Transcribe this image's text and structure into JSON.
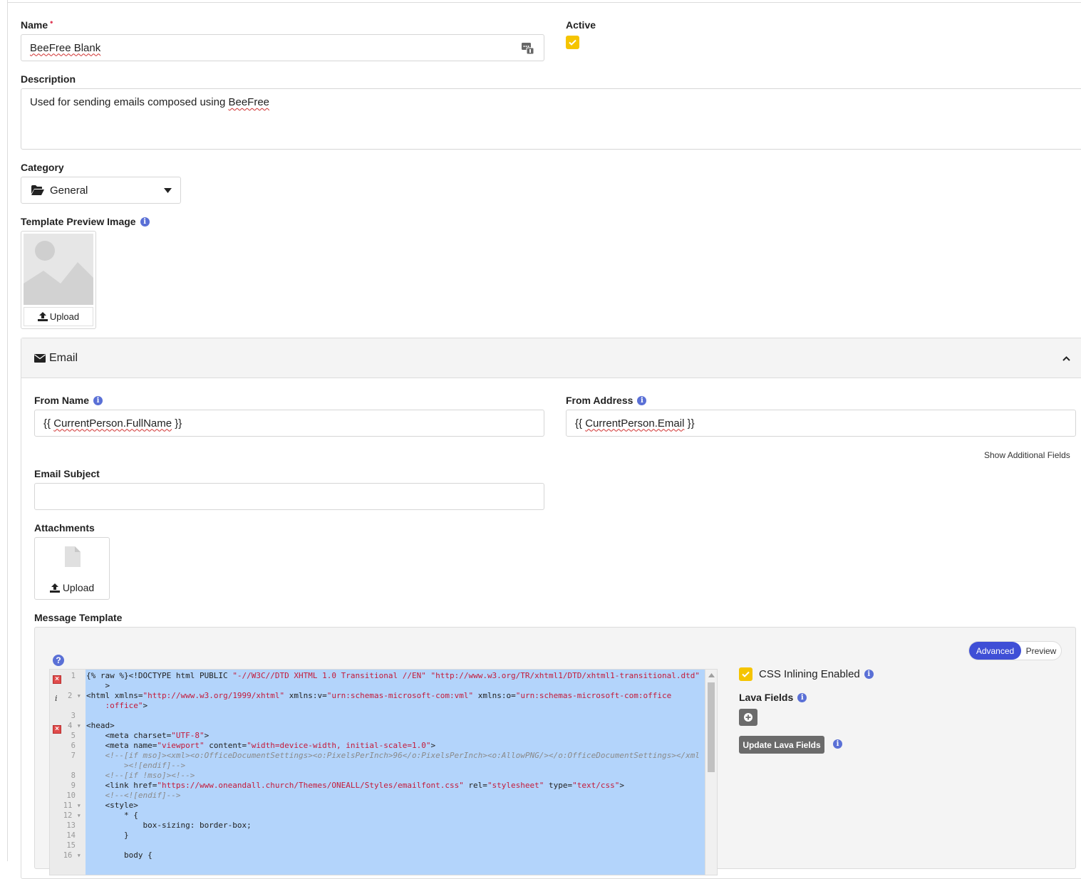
{
  "form": {
    "name_label": "Name",
    "name_required_marker": "•",
    "name_value": "BeeFree Blank",
    "active_label": "Active",
    "description_label": "Description",
    "description_value_prefix": "Used for sending emails composed using ",
    "description_value_word": "BeeFree",
    "category_label": "Category",
    "category_value": "General",
    "preview_image_label": "Template Preview Image",
    "preview_upload_label": "Upload"
  },
  "email_panel": {
    "title": "Email",
    "from_name_label": "From Name",
    "from_name_value_open": "{{ ",
    "from_name_value_word": "CurrentPerson.FullName",
    "from_name_value_close": " }}",
    "from_address_label": "From Address",
    "from_address_value_open": "{{ ",
    "from_address_value_word": "CurrentPerson.Email",
    "from_address_value_close": " }}",
    "show_additional_fields": "Show Additional Fields",
    "email_subject_label": "Email Subject",
    "email_subject_value": "",
    "attachments_label": "Attachments",
    "attachments_upload_label": "Upload",
    "message_template_label": "Message Template"
  },
  "editor": {
    "mode_advanced": "Advanced",
    "mode_preview": "Preview",
    "help_icon": "question-circle-icon",
    "css_inlining_label": "CSS Inlining Enabled",
    "lava_fields_label": "Lava Fields",
    "update_lava_fields": "Update Lava Fields",
    "code_lines": [
      {
        "n": "1",
        "fold": false,
        "gutter": "error",
        "parts": [
          [
            "p",
            "{% raw %}<!DOCTYPE html PUBLIC "
          ],
          [
            "s",
            "\"-//W3C//DTD XHTML 1.0 Transitional //EN\""
          ],
          [
            "p",
            " "
          ],
          [
            "s",
            "\"http://www.w3.org/TR/xhtml1/DTD/xhtml1-transitional.dtd\""
          ]
        ]
      },
      {
        "n": "",
        "fold": false,
        "gutter": "",
        "parts": [
          [
            "p",
            "    >"
          ]
        ]
      },
      {
        "n": "2",
        "fold": true,
        "gutter": "info",
        "parts": [
          [
            "p",
            "<html xmlns="
          ],
          [
            "s",
            "\"http://www.w3.org/1999/xhtml\""
          ],
          [
            "p",
            " xmlns:v="
          ],
          [
            "s",
            "\"urn:schemas-microsoft-com:vml\""
          ],
          [
            "p",
            " xmlns:o="
          ],
          [
            "s",
            "\"urn:schemas-microsoft-com:office"
          ]
        ]
      },
      {
        "n": "",
        "fold": false,
        "gutter": "",
        "parts": [
          [
            "s",
            "    :office\""
          ],
          [
            "p",
            ">"
          ]
        ]
      },
      {
        "n": "3",
        "fold": false,
        "gutter": "",
        "parts": []
      },
      {
        "n": "4",
        "fold": true,
        "gutter": "error",
        "parts": [
          [
            "p",
            "<head>"
          ]
        ]
      },
      {
        "n": "5",
        "fold": false,
        "gutter": "",
        "parts": [
          [
            "p",
            "    <meta charset="
          ],
          [
            "s",
            "\"UTF-8\""
          ],
          [
            "p",
            ">"
          ]
        ]
      },
      {
        "n": "6",
        "fold": false,
        "gutter": "",
        "parts": [
          [
            "p",
            "    <meta name="
          ],
          [
            "s",
            "\"viewport\""
          ],
          [
            "p",
            " content="
          ],
          [
            "s",
            "\"width=device-width, initial-scale=1.0\""
          ],
          [
            "p",
            ">"
          ]
        ]
      },
      {
        "n": "7",
        "fold": false,
        "gutter": "",
        "parts": [
          [
            "c",
            "    <!--[if mso]><xml><o:OfficeDocumentSettings><o:PixelsPerInch>96</o:PixelsPerInch><o:AllowPNG/></o:OfficeDocumentSettings></xml"
          ]
        ]
      },
      {
        "n": "",
        "fold": false,
        "gutter": "",
        "parts": [
          [
            "c",
            "        ><![endif]-->"
          ]
        ]
      },
      {
        "n": "8",
        "fold": false,
        "gutter": "",
        "parts": [
          [
            "c",
            "    <!--[if !mso]><!-->"
          ]
        ]
      },
      {
        "n": "9",
        "fold": false,
        "gutter": "",
        "parts": [
          [
            "p",
            "    <link href="
          ],
          [
            "s",
            "\"https://www.oneandall.church/Themes/ONEALL/Styles/emailfont.css\""
          ],
          [
            "p",
            " rel="
          ],
          [
            "s",
            "\"stylesheet\""
          ],
          [
            "p",
            " type="
          ],
          [
            "s",
            "\"text/css\""
          ],
          [
            "p",
            ">"
          ]
        ]
      },
      {
        "n": "10",
        "fold": false,
        "gutter": "",
        "parts": [
          [
            "c",
            "    <!--<![endif]-->"
          ]
        ]
      },
      {
        "n": "11",
        "fold": true,
        "gutter": "",
        "parts": [
          [
            "p",
            "    <style>"
          ]
        ]
      },
      {
        "n": "12",
        "fold": true,
        "gutter": "",
        "parts": [
          [
            "p",
            "        * {"
          ]
        ]
      },
      {
        "n": "13",
        "fold": false,
        "gutter": "",
        "parts": [
          [
            "p",
            "            box-sizing: border-box;"
          ]
        ]
      },
      {
        "n": "14",
        "fold": false,
        "gutter": "",
        "parts": [
          [
            "p",
            "        }"
          ]
        ]
      },
      {
        "n": "15",
        "fold": false,
        "gutter": "",
        "parts": []
      },
      {
        "n": "16",
        "fold": true,
        "gutter": "",
        "parts": [
          [
            "p",
            "        body {"
          ]
        ]
      }
    ]
  },
  "colors": {
    "accent": "#3f4fd6",
    "checkbox": "#f5c400",
    "selection": "#b3d4fb",
    "info": "#5a70d6"
  }
}
